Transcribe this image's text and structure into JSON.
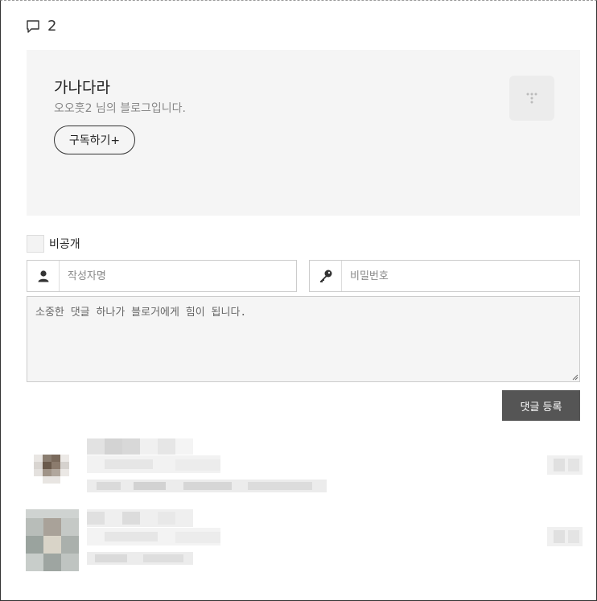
{
  "comments": {
    "count": "2",
    "icon": "speech-bubble-icon"
  },
  "blog": {
    "title": "가나다라",
    "description": "오오훗2 님의 블로그입니다.",
    "subscribe_label": "구독하기+",
    "logo_icon": "tistory-logo-icon"
  },
  "form": {
    "private_label": "비공개",
    "name_placeholder": "작성자명",
    "password_placeholder": "비밀번호",
    "comment_placeholder": "소중한 댓글 하나가 블로거에게 힘이 됩니다.",
    "submit_label": "댓글 등록",
    "name_icon": "user-icon",
    "password_icon": "key-icon"
  },
  "colors": {
    "card_bg": "#f5f5f5",
    "button_dark": "#555555",
    "border": "#cccccc"
  }
}
